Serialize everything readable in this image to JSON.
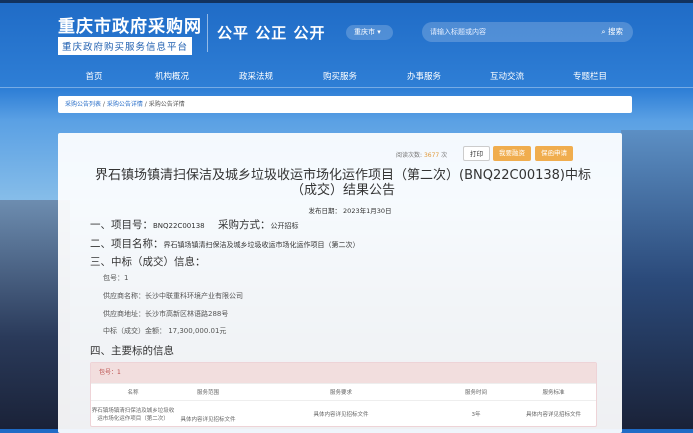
{
  "header": {
    "site_title": "重庆市政府采购网",
    "subtitle": "重庆政府购买服务信息平台",
    "slogan": "公平 公正 公开",
    "city_select": "重庆市",
    "search_placeholder": "请输入标题或内容",
    "search_button": "搜索"
  },
  "nav": [
    "首页",
    "机构概况",
    "政采法规",
    "购买服务",
    "办事服务",
    "互动交流",
    "专题栏目"
  ],
  "breadcrumb": [
    "采购公告列表",
    "采购公告详情",
    "采购公告详情"
  ],
  "article": {
    "views_label": "阅读次数:",
    "views": "3677",
    "views_unit": "次",
    "print": "打印",
    "finance": "我要融资",
    "guarantee": "保函申请",
    "title": "界石镇场镇清扫保洁及城乡垃圾收运市场化运作项目（第二次）(BNQ22C00138)中标（成交）结果公告",
    "date": "发布日期： 2023年1月30日",
    "s1_label": "一、项目号：",
    "s1_value": "BNQ22C00138",
    "s1b_label": "采购方式：",
    "s1b_value": "公开招标",
    "s2_label": "二、项目名称：",
    "s2_value": "界石镇场镇清扫保洁及城乡垃圾收运市场化运作项目（第二次）",
    "s3_label": "三、中标（成交）信息：",
    "package": "包号：1",
    "supplier": "供应商名称：长沙中联重科环境产业有限公司",
    "address": "供应商地址：长沙市高新区林语路288号",
    "amount": "中标（成交）金额： 17,300,000.01元",
    "s4_label": "四、主要标的信息"
  },
  "table": {
    "package": "包号：1",
    "headers": [
      "名称",
      "服务范围",
      "服务要求",
      "服务时间",
      "服务标准"
    ],
    "rows": [
      [
        "界石镇场镇清扫保洁及城乡垃圾收运市场化运作项目（第二次）",
        "具体内容详见招标文件",
        "具体内容详见招标文件",
        "3年",
        "具体内容详见招标文件"
      ]
    ]
  }
}
